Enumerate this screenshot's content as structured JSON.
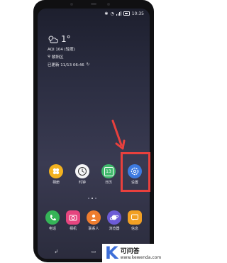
{
  "status_bar": {
    "time": "10:35"
  },
  "weather": {
    "temperature": "1°",
    "aqi": "AQI 104 (轻度)",
    "location": "朝阳区",
    "updated": "已更新 11/13 06:46"
  },
  "home_apps": [
    {
      "label": "相册"
    },
    {
      "label": "时钟"
    },
    {
      "label": "日历",
      "badge": "13"
    },
    {
      "label": "设置"
    }
  ],
  "dock_apps": [
    {
      "label": "电话"
    },
    {
      "label": "相机"
    },
    {
      "label": "联系人"
    },
    {
      "label": "浏览器"
    },
    {
      "label": "信息"
    }
  ],
  "colors": {
    "annotation": "#e8403d",
    "settings_blue": "#3d7ae0"
  },
  "watermark": {
    "logo": "K",
    "text": "可问答",
    "url": "www.kewenda.com"
  }
}
